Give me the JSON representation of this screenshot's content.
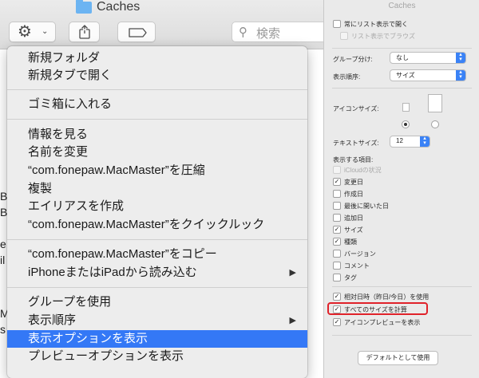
{
  "finder": {
    "window_title": "Caches",
    "search_placeholder": "検索",
    "edge_chars": [
      "B",
      "B",
      "e",
      "il",
      "M",
      "s"
    ],
    "icons": {
      "title_folder": "folder-icon",
      "action": "gear-icon",
      "share": "share-icon",
      "tag": "tag-icon",
      "search": "search-icon"
    }
  },
  "context_menu": {
    "items": [
      {
        "label": "新規フォルダ"
      },
      {
        "label": "新規タブで開く"
      },
      {
        "label": "ゴミ箱に入れる"
      },
      {
        "label": "情報を見る"
      },
      {
        "label": "名前を変更"
      },
      {
        "label": "“com.fonepaw.MacMaster”を圧縮"
      },
      {
        "label": "複製"
      },
      {
        "label": "エイリアスを作成"
      },
      {
        "label": "“com.fonepaw.MacMaster”をクイックルック"
      },
      {
        "label": "“com.fonepaw.MacMaster”をコピー"
      },
      {
        "label": "iPhoneまたはiPadから読み込む"
      },
      {
        "label": "グループを使用"
      },
      {
        "label": "表示順序"
      },
      {
        "label": "表示オプションを表示"
      },
      {
        "label": "プレビューオプションを表示"
      }
    ],
    "highlighted_item": "表示オプションを表示",
    "highlight_color": "#3478f6",
    "submenu_arrow": "▶"
  },
  "view_options": {
    "title": "Caches",
    "always_list_view": "常にリスト表示で開く",
    "browse_list_view": "リスト表示でブラウズ",
    "group_by_label": "グループ分け:",
    "group_by_value": "なし",
    "sort_by_label": "表示順序:",
    "sort_by_value": "サイズ",
    "icon_size_label": "アイコンサイズ:",
    "text_size_label": "テキストサイズ:",
    "text_size_value": "12",
    "show_columns_label": "表示する項目:",
    "columns": [
      {
        "label": "iCloudの状況",
        "checked": false,
        "disabled": true
      },
      {
        "label": "変更日",
        "checked": true,
        "disabled": false
      },
      {
        "label": "作成日",
        "checked": false,
        "disabled": false
      },
      {
        "label": "最後に開いた日",
        "checked": false,
        "disabled": false
      },
      {
        "label": "追加日",
        "checked": false,
        "disabled": false
      },
      {
        "label": "サイズ",
        "checked": true,
        "disabled": false
      },
      {
        "label": "種類",
        "checked": true,
        "disabled": false
      },
      {
        "label": "バージョン",
        "checked": false,
        "disabled": false
      },
      {
        "label": "コメント",
        "checked": false,
        "disabled": false
      },
      {
        "label": "タグ",
        "checked": false,
        "disabled": false
      }
    ],
    "relative_dates": "相対日時（昨日/今日）を使用",
    "calculate_all_sizes": "すべてのサイズを計算",
    "icon_preview": "アイコンプレビューを表示",
    "default_button": "デフォルトとして使用",
    "check_mark": "✓",
    "annotation_color": "#e0222a"
  }
}
